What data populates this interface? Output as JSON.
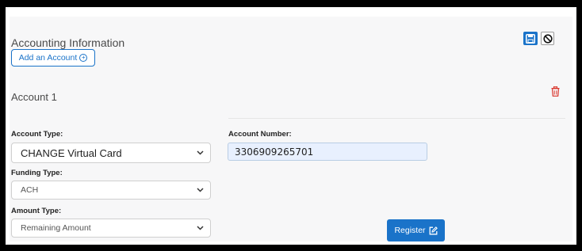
{
  "section": {
    "title": "Accounting Information"
  },
  "toolbar": {
    "add_account_label": "Add an Account",
    "add_icon": "plus-circle-icon",
    "save_icon": "floppy-disk-icon",
    "cancel_icon": "prohibited-icon",
    "accent_color": "#1a73c9"
  },
  "account": {
    "title": "Account 1",
    "delete_icon": "trash-icon",
    "delete_color": "#d9342b",
    "account_type": {
      "label": "Account Type:",
      "value": "CHANGE Virtual Card"
    },
    "account_number": {
      "label": "Account Number:",
      "value": "3306909265701"
    },
    "funding_type": {
      "label": "Funding Type:",
      "value": "ACH"
    },
    "amount_type": {
      "label": "Amount Type:",
      "value": "Remaining Amount"
    },
    "register": {
      "label": "Register",
      "icon": "edit-box-icon"
    }
  }
}
